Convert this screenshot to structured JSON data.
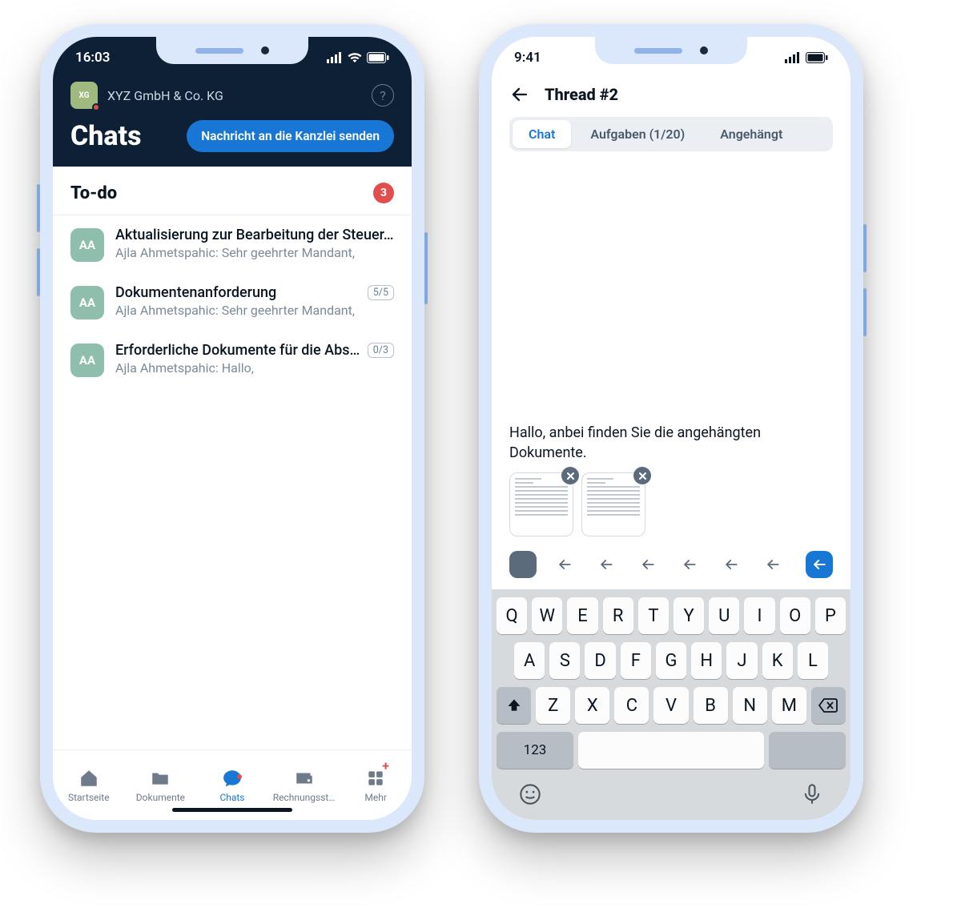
{
  "left": {
    "status": {
      "time": "16:03"
    },
    "org": {
      "initials": "XG",
      "name": "XYZ GmbH & Co. KG"
    },
    "title": "Chats",
    "send_button": "Nachricht an die Kanzlei senden",
    "section": {
      "title": "To-do",
      "badge": "3"
    },
    "chats": [
      {
        "initials": "AA",
        "title": "Aktualisierung zur Bearbeitung der Steuer…",
        "sub": "Ajla Ahmetspahic: Sehr geehrter Mandant,",
        "count": ""
      },
      {
        "initials": "AA",
        "title": "Dokumentenanforderung",
        "sub": "Ajla Ahmetspahic: Sehr geehrter Mandant,",
        "count": "5/5"
      },
      {
        "initials": "AA",
        "title": "Erforderliche Dokumente für die Absc…",
        "sub": "Ajla Ahmetspahic: Hallo,",
        "count": "0/3"
      }
    ],
    "tabs": [
      {
        "label": "Startseite"
      },
      {
        "label": "Dokumente"
      },
      {
        "label": "Chats"
      },
      {
        "label": "Rechnungsst…"
      },
      {
        "label": "Mehr"
      }
    ]
  },
  "right": {
    "status": {
      "time": "9:41"
    },
    "thread_title": "Thread #2",
    "segments": [
      {
        "label": "Chat",
        "active": true
      },
      {
        "label": "Aufgaben (1/20)",
        "active": false
      },
      {
        "label": "Angehängt",
        "active": false
      }
    ],
    "compose_text": "Hallo, anbei finden Sie die angehängten Dokumente.",
    "keyboard": {
      "r1": [
        "Q",
        "W",
        "E",
        "R",
        "T",
        "Y",
        "U",
        "I",
        "O",
        "P"
      ],
      "r2": [
        "A",
        "S",
        "D",
        "F",
        "G",
        "H",
        "J",
        "K",
        "L"
      ],
      "r3": [
        "Z",
        "X",
        "C",
        "V",
        "B",
        "N",
        "M"
      ],
      "num": "123"
    }
  }
}
